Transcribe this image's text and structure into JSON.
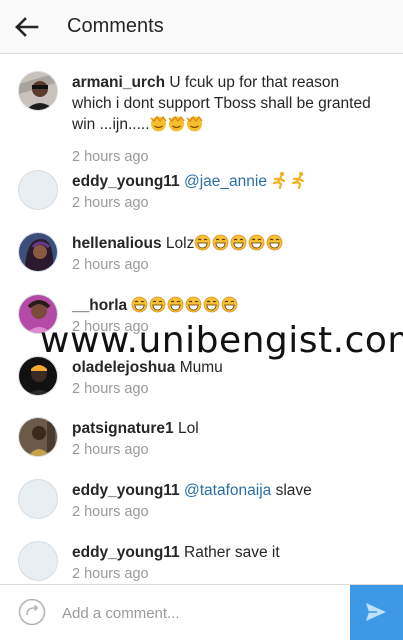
{
  "header": {
    "title": "Comments",
    "back_icon": "arrow-left-icon"
  },
  "comments": [
    {
      "username": "armani_urch",
      "text": "U fcuk up for that reason which i dont support Tboss shall be granted win ...ijn.....",
      "emojis": [
        "money-face",
        "money-face",
        "money-face"
      ],
      "time": "2 hours ago",
      "avatar": "photo"
    },
    {
      "username": "eddy_young11",
      "mention": "@jae_annie",
      "emojis": [
        "running-man",
        "running-man"
      ],
      "time": "2 hours ago",
      "avatar": "placeholder"
    },
    {
      "username": "hellenalious",
      "text": "Lolz",
      "emojis": [
        "grin",
        "grin",
        "grin",
        "grin",
        "grin"
      ],
      "time": "2 hours ago",
      "avatar": "photo"
    },
    {
      "username": "__horla",
      "emojis": [
        "grin",
        "grin",
        "grin",
        "grin",
        "grin",
        "grin"
      ],
      "time": "2 hours ago",
      "avatar": "photo"
    },
    {
      "username": "oladelejoshua",
      "text": "Mumu",
      "time": "2 hours ago",
      "avatar": "photo"
    },
    {
      "username": "patsignature1",
      "text": "Lol",
      "time": "2 hours ago",
      "avatar": "photo"
    },
    {
      "username": "eddy_young11",
      "mention": "@tatafonaija",
      "text": "slave",
      "time": "2 hours ago",
      "avatar": "placeholder"
    },
    {
      "username": "eddy_young11",
      "text": "Rather save it",
      "time": "2 hours ago",
      "avatar": "placeholder"
    }
  ],
  "watermark": "www.unibengist.com",
  "composer": {
    "placeholder": "Add a comment...",
    "icon": "refresh-icon",
    "send_icon": "send-icon"
  },
  "colors": {
    "accent": "#3d99e6",
    "mention": "#2b6ea7",
    "muted": "#9a9a9a"
  }
}
